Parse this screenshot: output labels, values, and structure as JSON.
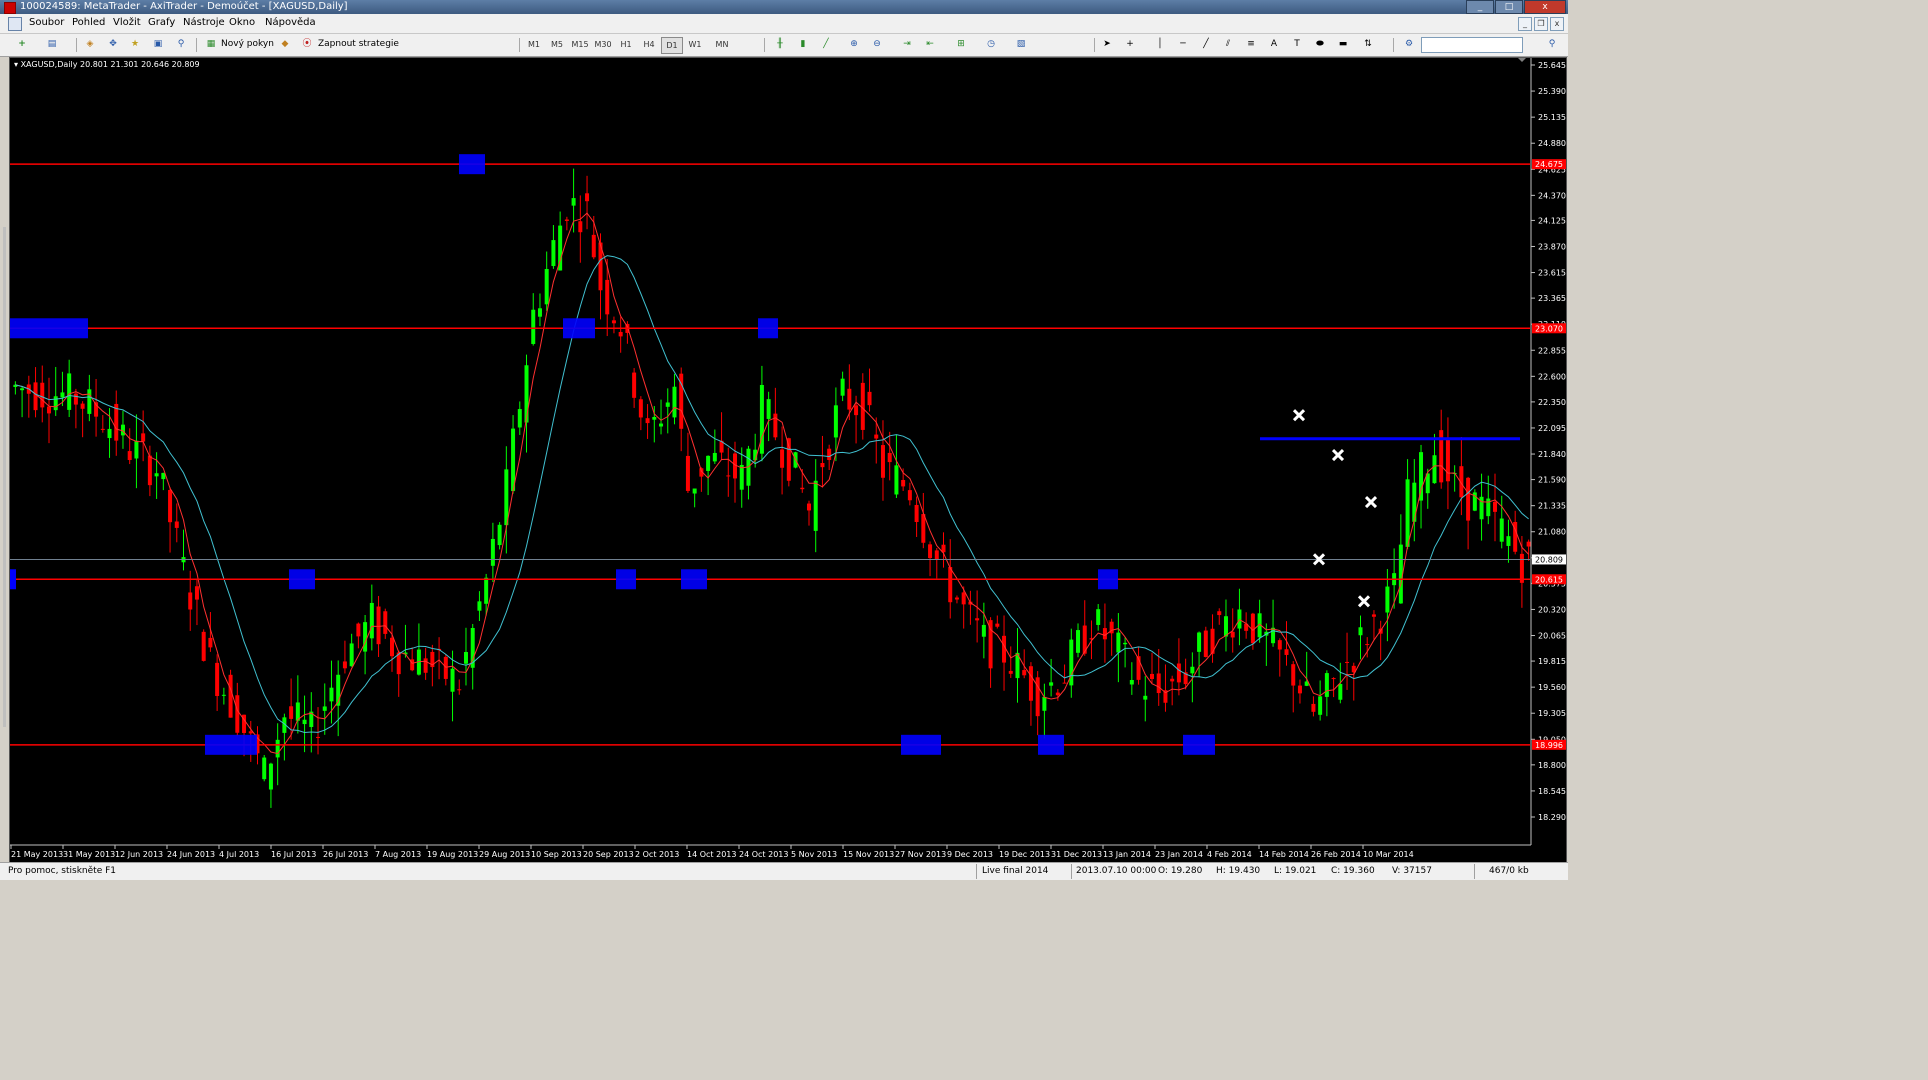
{
  "window": {
    "title": "100024589: MetaTrader - AxiTrader - Demoúčet - [XAGUSD,Daily]",
    "controls": [
      "_",
      "□",
      "x"
    ]
  },
  "menu": [
    "Soubor",
    "Pohled",
    "Vložit",
    "Grafy",
    "Nástroje",
    "Okno",
    "Nápověda"
  ],
  "toolbar": {
    "new_order": "Nový pokyn",
    "strategies": "Zapnout strategie",
    "timeframes": [
      "M1",
      "M5",
      "M15",
      "M30",
      "H1",
      "H4",
      "D1",
      "W1",
      "MN"
    ],
    "active_timeframe": "D1"
  },
  "chart": {
    "symbol_line": "XAGUSD,Daily  20.801 21.301 20.646 20.809",
    "colors": {
      "background": "#000000",
      "bull": "#00ff00",
      "bear": "#ff0000",
      "ma_fast": "#ff3030",
      "ma_slow": "#40c0d0",
      "level": "#ff0000",
      "resistance": "#0000ff",
      "zone": "#0000ff",
      "marker": "#ffffff"
    },
    "price_scale": [
      "25.645",
      "25.390",
      "25.135",
      "24.880",
      "24.625",
      "24.370",
      "24.125",
      "23.870",
      "23.615",
      "23.365",
      "23.110",
      "22.855",
      "22.600",
      "22.350",
      "22.095",
      "21.840",
      "21.590",
      "21.335",
      "21.080",
      "20.825",
      "20.575",
      "20.320",
      "20.065",
      "19.815",
      "19.560",
      "19.305",
      "19.050",
      "18.800",
      "18.545",
      "18.290"
    ],
    "current_price": "20.809",
    "level_labels": [
      "24.675",
      "23.070",
      "20.615",
      "18.996"
    ],
    "date_scale": [
      "21 May 2013",
      "31 May 2013",
      "12 Jun 2013",
      "24 Jun 2013",
      "4 Jul 2013",
      "16 Jul 2013",
      "26 Jul 2013",
      "7 Aug 2013",
      "19 Aug 2013",
      "29 Aug 2013",
      "10 Sep 2013",
      "20 Sep 2013",
      "2 Oct 2013",
      "14 Oct 2013",
      "24 Oct 2013",
      "5 Nov 2013",
      "15 Nov 2013",
      "27 Nov 2013",
      "9 Dec 2013",
      "19 Dec 2013",
      "31 Dec 2013",
      "13 Jan 2014",
      "23 Jan 2014",
      "4 Feb 2014",
      "14 Feb 2014",
      "26 Feb 2014",
      "10 Mar 2014"
    ]
  },
  "status": {
    "help": "Pro pomoc, stiskněte F1",
    "profile": "Live final 2014",
    "datetime": "2013.07.10 00:00",
    "open": "O: 19.280",
    "high": "H: 19.430",
    "low": "L: 19.021",
    "close": "C: 19.360",
    "volume": "V: 37157",
    "traffic": "467/0 kb"
  }
}
